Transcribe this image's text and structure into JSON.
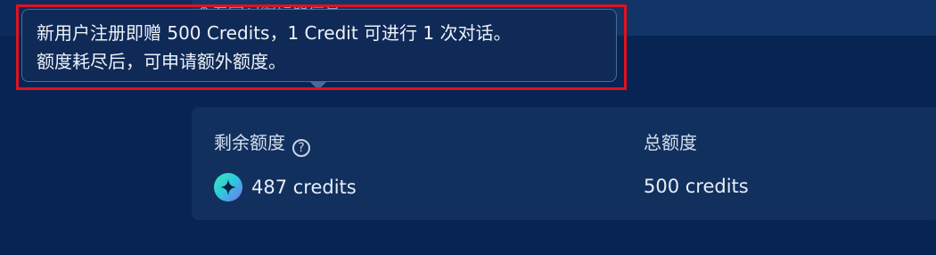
{
  "header": {
    "partial_text": "查看学习编辑器信息"
  },
  "tooltip": {
    "line1": "新用户注册即赠 500 Credits，1 Credit 可进行 1 次对话。",
    "line2": "额度耗尽后，可申请额外额度。"
  },
  "quota": {
    "remaining_label": "剩余额度",
    "help_symbol": "?",
    "remaining_value": "487 credits",
    "total_label": "总额度",
    "total_value": "500 credits"
  },
  "colors": {
    "background": "#082452",
    "card": "#11305e",
    "highlight": "#e0121e",
    "tooltip_border": "#4b6a96"
  },
  "icons": {
    "credit": "sparkle-icon",
    "help": "question-circle-icon"
  }
}
